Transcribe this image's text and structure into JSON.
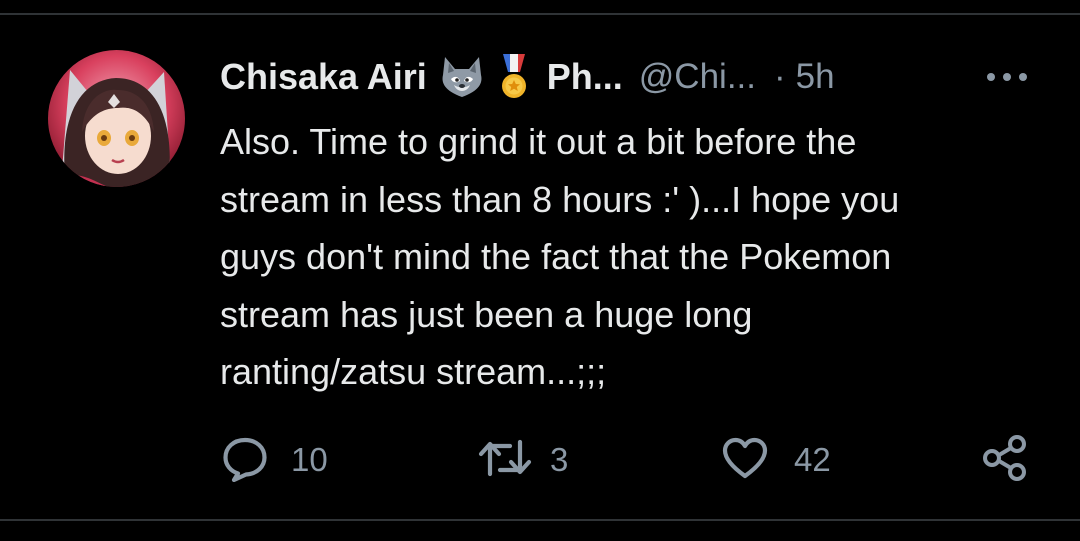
{
  "tweet": {
    "author": {
      "display_name": "Chisaka Airi",
      "affiliation_truncated": "Ph...",
      "handle_truncated": "@Chi...",
      "badges": [
        "wolf-emoji",
        "medal-emoji"
      ]
    },
    "separator": "·",
    "timestamp": "5h",
    "text_lines": [
      "Also. Time to grind it out a bit before the",
      "stream in less than 8 hours :' )...I hope you",
      "guys don't mind the fact that the Pokemon",
      "stream has just been a huge long",
      "ranting/zatsu stream...;;;"
    ],
    "actions": {
      "reply_count": "10",
      "retweet_count": "3",
      "like_count": "42"
    }
  },
  "colors": {
    "background": "#000000",
    "text_primary": "#e7e9ea",
    "text_secondary": "#8b98a5",
    "divider": "#2f3336"
  }
}
